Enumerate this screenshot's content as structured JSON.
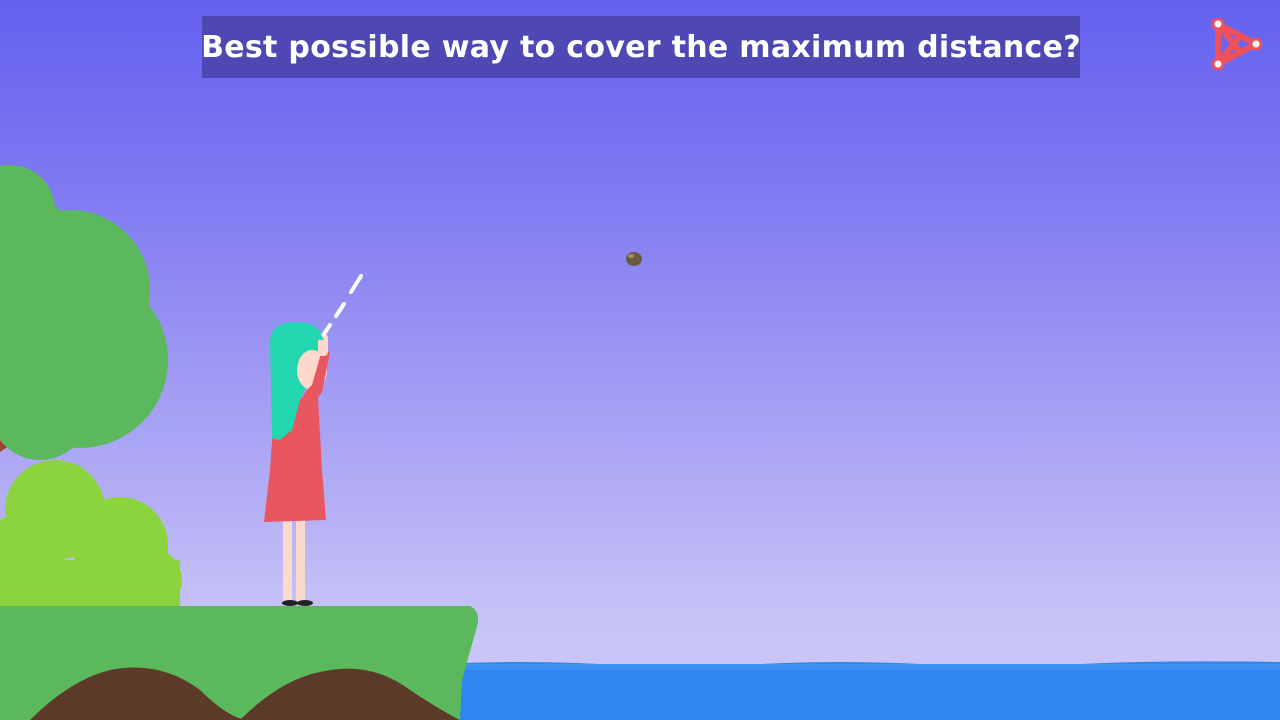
{
  "title": "Best possible way to cover the maximum distance?",
  "icons": {
    "logo": "play-logo-icon",
    "stone": "stone-icon"
  },
  "colors": {
    "sky_top": "#6560ef",
    "sky_bottom": "#cdc9f8",
    "banner": "#4d48b3",
    "tree": "#5cb85c",
    "bush": "#8cd43e",
    "ground": "#5cb85c",
    "soil": "#5b3a2a",
    "water": "#2f86f0",
    "hair": "#22d7b0",
    "dress": "#e8575f",
    "logo": "#f0505a"
  }
}
